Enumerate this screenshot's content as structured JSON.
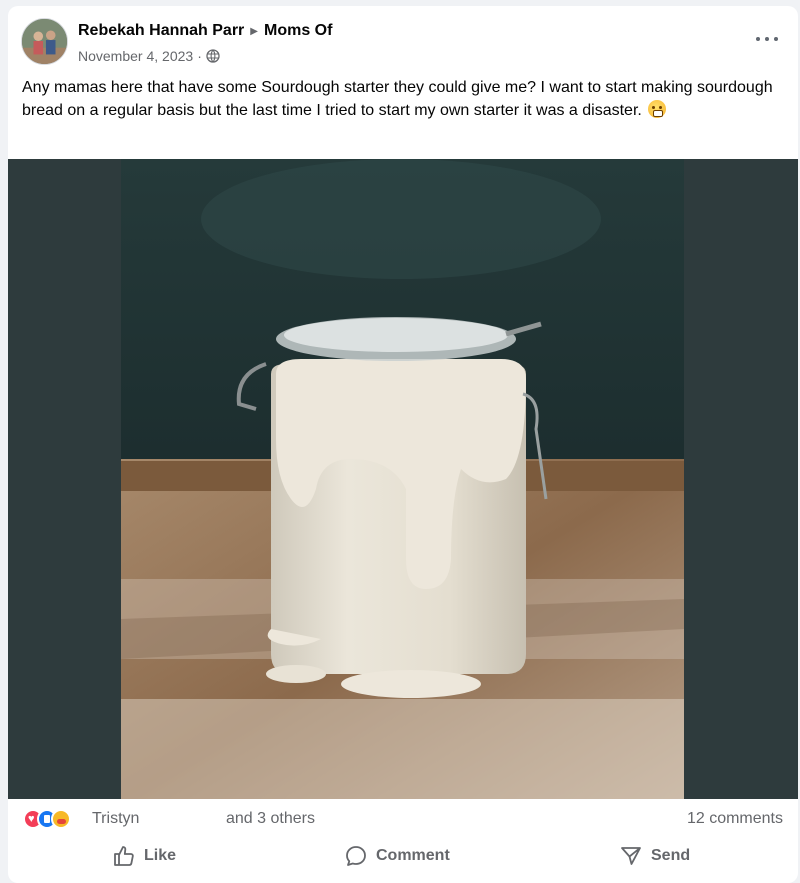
{
  "post": {
    "author": "Rebekah Hannah Parr",
    "group": "Moms Of",
    "date": "November 4, 2023",
    "date_separator": "·",
    "privacy_icon": "globe-icon",
    "message": "Any mamas here that have some Sourdough starter they could give me? I want to start making sourdough bread on a regular basis but the last time I tried to start my own starter it was a disaster.",
    "message_emoji": "grimacing-face-emoji"
  },
  "reactions": {
    "icons": [
      "love-icon",
      "like-icon",
      "care-icon"
    ],
    "reactor_name": "Tristyn",
    "others_text": "and 3 others",
    "comments_text": "12 comments"
  },
  "actions": {
    "like_label": "Like",
    "comment_label": "Comment",
    "send_label": "Send"
  },
  "colors": {
    "media_background": "#2e3b3d",
    "secondary_text": "#65676b",
    "like_blue": "#1877f2",
    "love_red": "#f33e58"
  }
}
